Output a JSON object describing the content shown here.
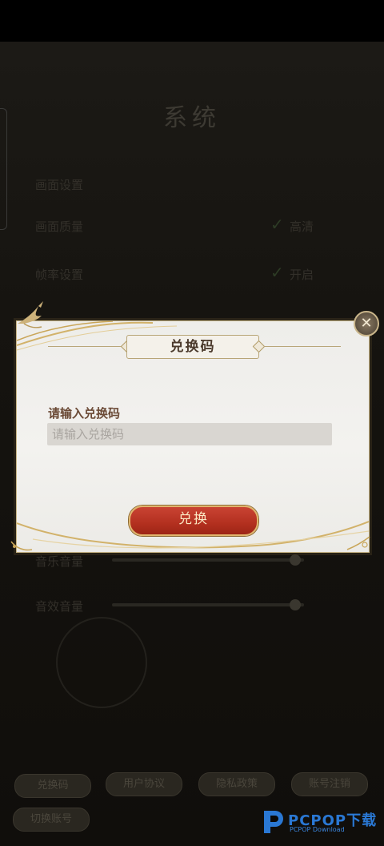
{
  "background": {
    "title": "系统",
    "rows": [
      {
        "label": "画面质量",
        "option": "高清"
      },
      {
        "label": "帧率设置",
        "option": "开启"
      }
    ],
    "sliders": [
      {
        "label": "音乐音量"
      },
      {
        "label": "音效音量"
      }
    ],
    "buttons": [
      "兑换码",
      "用户协议",
      "隐私政策",
      "账号注销",
      "切换账号"
    ]
  },
  "dialog": {
    "title": "兑换码",
    "label": "请输入兑换码",
    "input_placeholder": "请输入兑换码",
    "input_value": "",
    "redeem_label": "兑换",
    "close_glyph": "✕"
  },
  "watermark": {
    "brand": "PCPOP下载",
    "sub": "PCPOP Download"
  },
  "colors": {
    "accent_red": "#b3301f",
    "gold_border": "#c6b383",
    "label_brown": "#6b4a36"
  }
}
